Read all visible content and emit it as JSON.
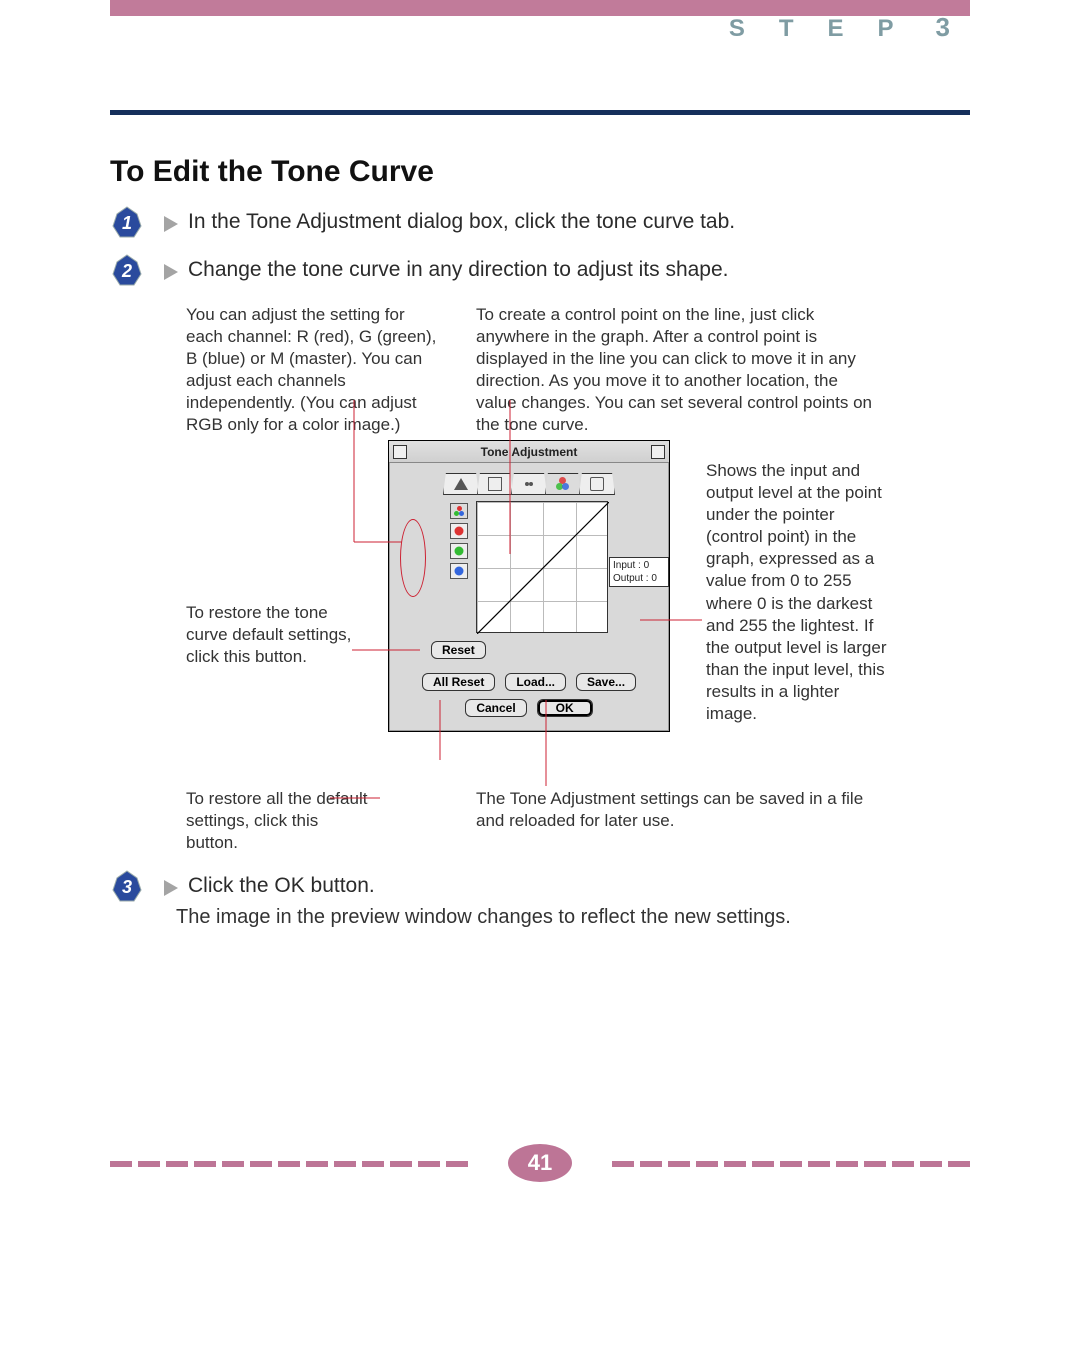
{
  "header": {
    "step_word": "STEP",
    "step_number": "3"
  },
  "title": "To Edit the Tone Curve",
  "steps": [
    {
      "num": "1",
      "text": "In the Tone Adjustment dialog box, click the tone curve tab."
    },
    {
      "num": "2",
      "text": "Change the tone curve in any direction to adjust its shape."
    },
    {
      "num": "3",
      "text": "Click the OK button."
    }
  ],
  "step3_sub": "The image in the preview window changes to reflect the new settings.",
  "paras": {
    "channel_note": "You can adjust the setting for each channel: R (red), G (green), B (blue) or M (master). You can adjust each channels independently. (You can adjust RGB only for a color image.)",
    "controlpoint_note": "To create a control point on the line, just click anywhere in the graph. After a control point is displayed in the line you can click to move it in any direction. As you move it to another location, the value changes. You can set several control points on the tone curve."
  },
  "callouts": {
    "reset_note": "To restore the tone curve default settings, click this button.",
    "allreset_note": "To restore all the default settings, click this button.",
    "save_note": "The Tone Adjustment settings can be saved in a file and reloaded for later use.",
    "io_note": "Shows the input and output level at the point under the pointer (control point) in the graph, expressed as a value from 0 to 255 where 0 is the darkest and 255 the lightest. If the output level is larger than the input level, this results in a lighter image."
  },
  "dialog": {
    "title": "Tone Adjustment",
    "input_label": "Input : 0",
    "output_label": "Output : 0",
    "reset": "Reset",
    "all_reset": "All Reset",
    "load": "Load...",
    "save": "Save...",
    "cancel": "Cancel",
    "ok": "OK"
  },
  "page_number": "41"
}
